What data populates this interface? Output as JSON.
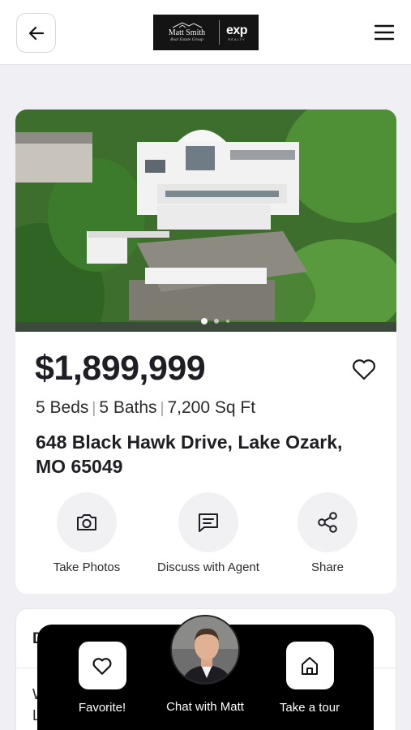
{
  "header": {
    "logo": {
      "name": "Matt Smith",
      "sub": "Real Estate Group",
      "brand": "exp",
      "brand_sub": "REALTY"
    },
    "back_icon": "arrow-left-icon",
    "menu_icon": "hamburger-menu-icon"
  },
  "listing": {
    "price": "$1,899,999",
    "beds": "5 Beds",
    "baths": "5 Baths",
    "sqft": "7,200 Sq Ft",
    "address": "648 Black Hawk Drive, Lake Ozark, MO 65049",
    "photo_count": 3,
    "photo_active_index": 0,
    "actions": [
      {
        "label": "Take Photos",
        "icon": "camera-icon"
      },
      {
        "label": "Discuss with Agent",
        "icon": "chat-bubble-icon"
      },
      {
        "label": "Share",
        "icon": "share-icon"
      }
    ]
  },
  "section2": {
    "title_partial": "D",
    "text_partial": "W L"
  },
  "bottom_bar": {
    "favorite": "Favorite!",
    "chat": "Chat with Matt",
    "tour": "Take a tour"
  },
  "colors": {
    "background": "#f0f0f4",
    "card": "#ffffff",
    "bottom_bar": "#000000",
    "text": "#1e1e24"
  }
}
